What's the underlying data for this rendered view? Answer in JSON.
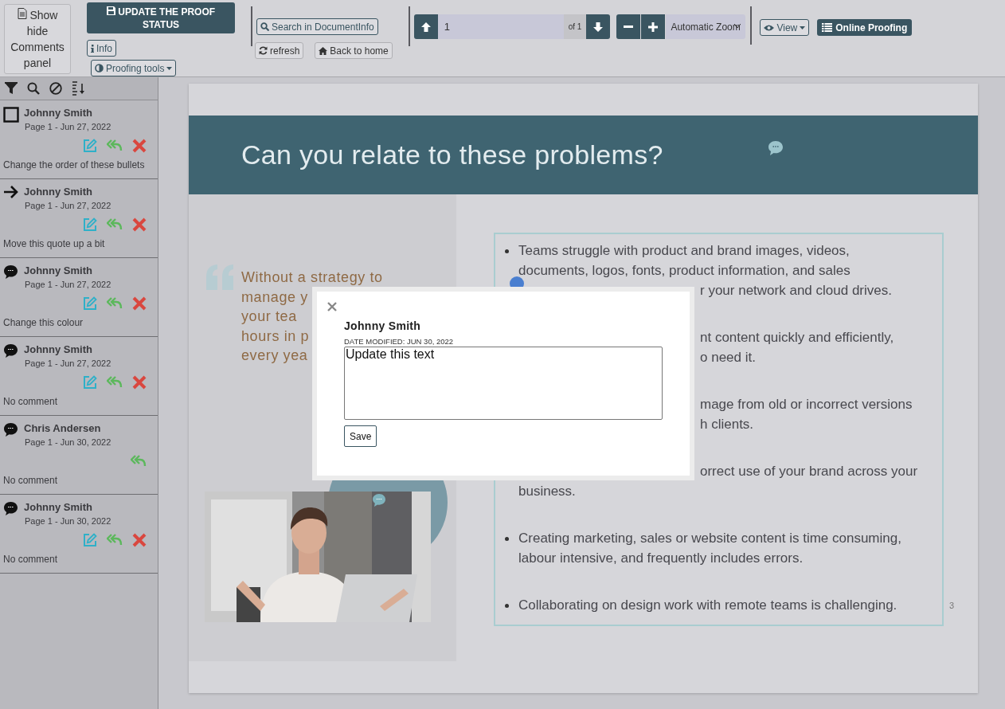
{
  "toolbar": {
    "panel_toggle": "Show hide Comments panel",
    "update_status": "UPDATE THE PROOF STATUS",
    "info": "Info",
    "proofing_tools": "Proofing tools",
    "search": "Search in DocumentInfo",
    "refresh": "refresh",
    "home": "Back to home",
    "page_number": "1",
    "page_count": "of 1",
    "zoom": "Automatic Zoom",
    "view": "View",
    "online_proofing": "Online Proofing"
  },
  "comments": [
    {
      "kind": "square",
      "author": "Johnny Smith",
      "meta": "Page 1 - Jun 27, 2022",
      "editable": true,
      "deletable": true,
      "text": "Change the order of these bullets"
    },
    {
      "kind": "arrow",
      "author": "Johnny Smith",
      "meta": "Page 1 - Jun 27, 2022",
      "editable": true,
      "deletable": true,
      "text": "Move this quote up a bit"
    },
    {
      "kind": "speech",
      "author": "Johnny Smith",
      "meta": "Page 1 - Jun 27, 2022",
      "editable": true,
      "deletable": true,
      "text": "Change this colour"
    },
    {
      "kind": "speech",
      "author": "Johnny Smith",
      "meta": "Page 1 - Jun 27, 2022",
      "editable": true,
      "deletable": true,
      "text": "No comment"
    },
    {
      "kind": "speech",
      "author": "Chris Andersen",
      "meta": "Page 1 - Jun 30, 2022",
      "editable": false,
      "deletable": false,
      "text": "No comment"
    },
    {
      "kind": "speech",
      "author": "Johnny Smith",
      "meta": "Page 1 - Jun 30, 2022",
      "editable": true,
      "deletable": true,
      "text": "No comment"
    }
  ],
  "document": {
    "title": "Can you relate to these problems?",
    "quote_lines": [
      "Without a strategy to",
      "manage y",
      "your tea",
      "hours in p",
      "every yea"
    ],
    "bullets": [
      {
        "lines": [
          {
            "text": "Teams struggle with product and brand images, videos,",
            "covered": false
          },
          {
            "text": "documents, logos, fonts, product information, and sales",
            "covered": false
          },
          {
            "text": "r your network and cloud drives.",
            "covered": true
          }
        ]
      },
      {
        "lines": [
          {
            "text": "nt content quickly and efficiently,",
            "covered": true
          },
          {
            "text": "o need it.",
            "covered": true
          }
        ]
      },
      {
        "lines": [
          {
            "text": "mage from old or incorrect versions",
            "covered": true
          },
          {
            "text": "h clients.",
            "covered": true
          }
        ]
      },
      {
        "lines": [
          {
            "text": "orrect use of your brand across your",
            "covered": true
          },
          {
            "text": "business.",
            "covered": false
          }
        ]
      },
      {
        "lines": [
          {
            "text": "Creating marketing, sales or website content is time consuming,",
            "covered": false
          },
          {
            "text": "labour intensive, and frequently includes errors.",
            "covered": false
          }
        ]
      },
      {
        "lines": [
          {
            "text": "Collaborating on design work with remote teams is challenging.",
            "covered": false
          }
        ]
      }
    ],
    "page_number": "3"
  },
  "dialog": {
    "author": "Johnny Smith",
    "date": "DATE MODIFIED: JUN 30, 2022",
    "value": "Update this text",
    "save": "Save"
  }
}
